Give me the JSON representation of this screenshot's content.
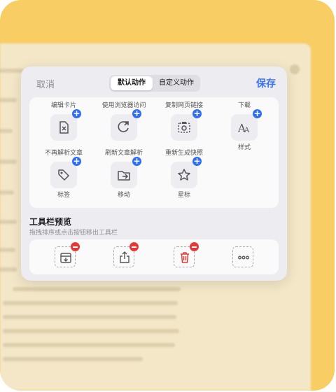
{
  "header": {
    "cancel_label": "取消",
    "save_label": "保存",
    "segments": [
      "默认动作",
      "自定义动作"
    ],
    "active_segment": "默认动作"
  },
  "actions": [
    {
      "label": "编辑卡片",
      "label_position": "top",
      "icon": "edit-card-icon"
    },
    {
      "label": "使用浏览器访问",
      "label_position": "top",
      "icon": "browser-icon"
    },
    {
      "label": "复制网页链接",
      "label_position": "top",
      "icon": "copy-link-icon"
    },
    {
      "label": "下载",
      "label_position": "top",
      "icon": "download-icon"
    },
    {
      "label": "不再解析文章",
      "label_position": "top",
      "icon": "no-parse-icon"
    },
    {
      "label": "刷新文章解析",
      "label_position": "top",
      "icon": "refresh-parse-icon"
    },
    {
      "label": "重新生成快照",
      "label_position": "top",
      "icon": "snapshot-icon"
    },
    {
      "label": "样式",
      "label_position": "bottom",
      "icon": "font-style-icon"
    },
    {
      "label": "标签",
      "label_position": "bottom",
      "icon": "tag-icon"
    },
    {
      "label": "移动",
      "label_position": "bottom",
      "icon": "move-folder-icon"
    },
    {
      "label": "星标",
      "label_position": "bottom",
      "icon": "star-icon"
    }
  ],
  "toolbar_preview": {
    "title": "工具栏预览",
    "subtitle": "拖拽排序或点击按钮移出工具栏",
    "items": [
      {
        "icon": "archive-icon"
      },
      {
        "icon": "share-icon"
      },
      {
        "icon": "trash-icon",
        "color": "#e53935"
      },
      {
        "icon": "more-icon"
      }
    ]
  },
  "colors": {
    "accent": "#3d73f0",
    "add_badge": "#2f6df5",
    "remove_badge": "#e53935",
    "frame": "#f8cd63"
  }
}
